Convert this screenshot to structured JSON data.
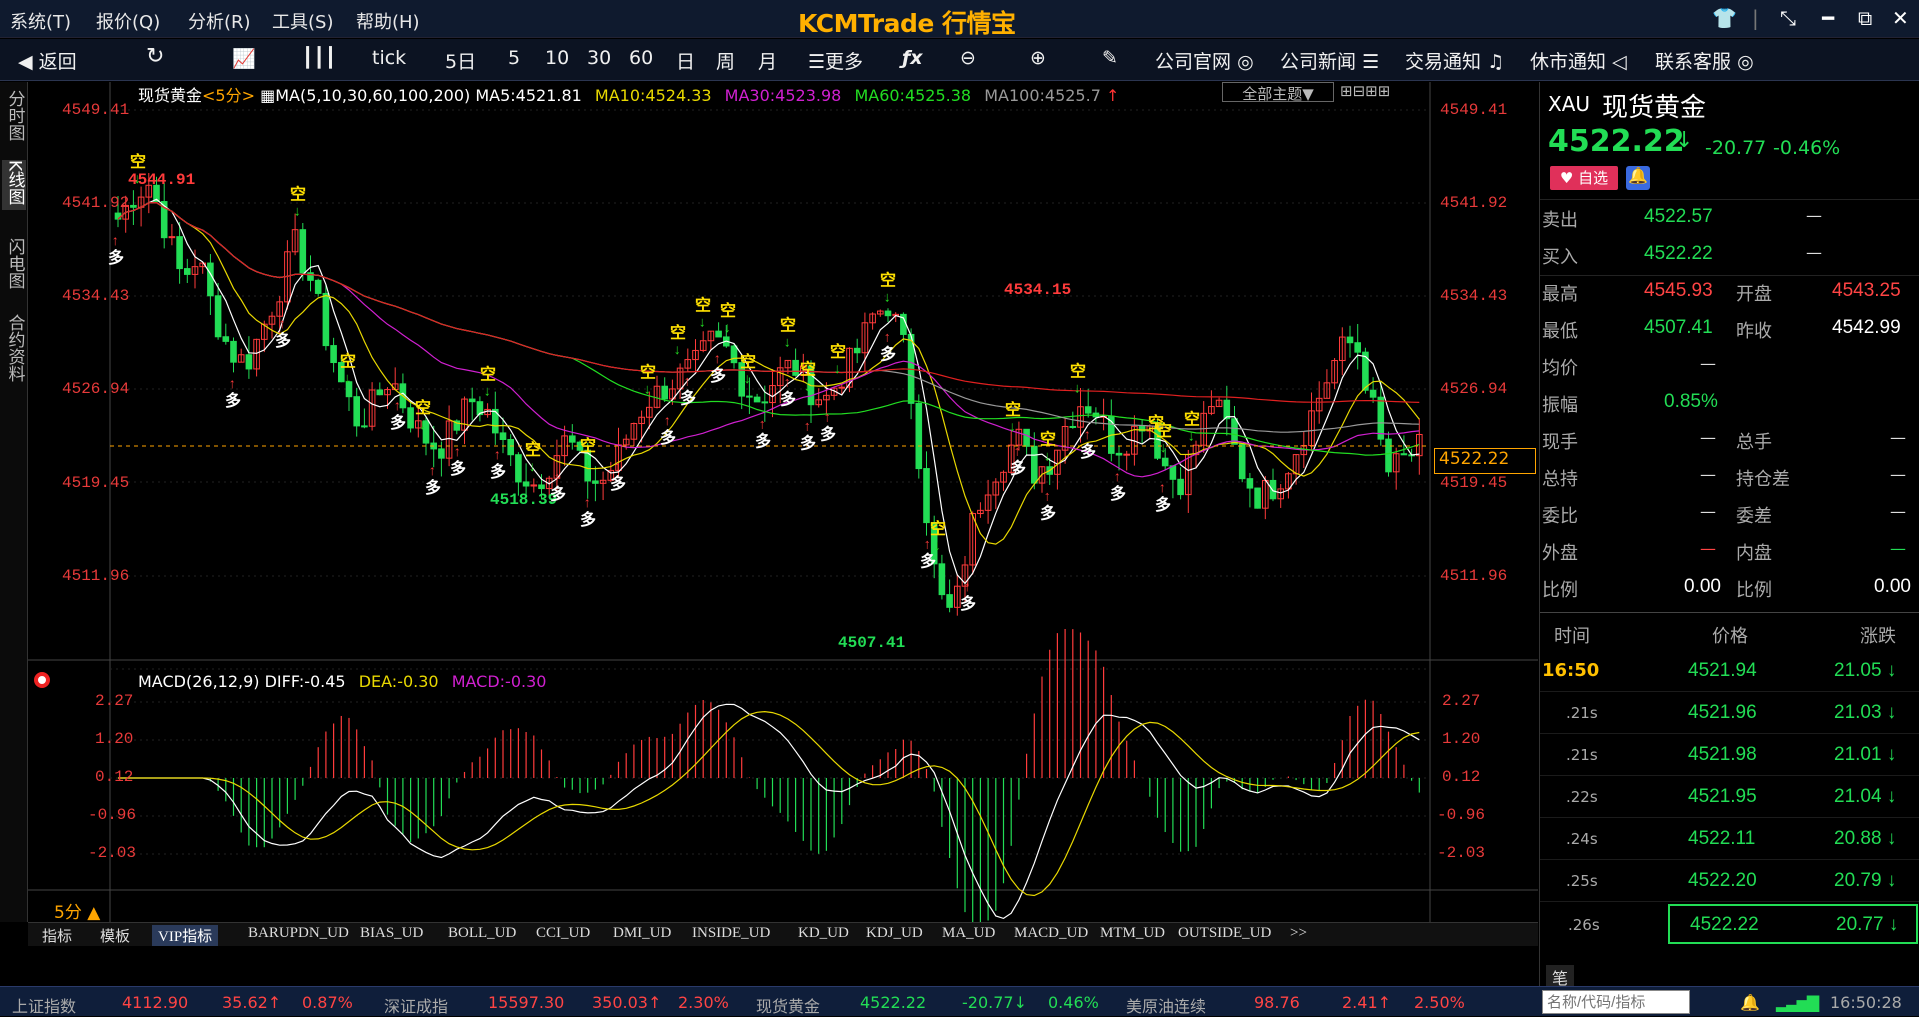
{
  "app": {
    "logo": "KCMTrade 行情宝"
  },
  "menu": [
    "系统(T)",
    "报价(Q)",
    "分析(R)",
    "工具(S)",
    "帮助(H)"
  ],
  "toolbar": {
    "back": "返回",
    "tick": "tick",
    "periods": [
      "5日",
      "5",
      "10",
      "30",
      "60",
      "日",
      "周",
      "月"
    ],
    "more": "更多",
    "links": [
      "公司官网",
      "公司新闻",
      "交易通知",
      "休市通知",
      "联系客服"
    ]
  },
  "left_tabs": [
    "分时图",
    "K线图",
    "闪电图",
    "合约资料"
  ],
  "main_header": {
    "symbol": "现货黄金",
    "period": "<5分>",
    "ma_def": "MA(5,10,30,60,100,200)",
    "ma5": "MA5:4521.81",
    "ma10": "MA10:4524.33",
    "ma30": "MA30:4523.98",
    "ma60": "MA60:4525.38",
    "ma100": "MA100:4525.7",
    "theme": "全部主题▼"
  },
  "price_axis": [
    "4549.41",
    "4541.92",
    "4534.43",
    "4526.94",
    "4519.45",
    "4511.96"
  ],
  "macd_axis": [
    "2.27",
    "1.20",
    "0.12",
    "-0.96",
    "-2.03"
  ],
  "price_tag": "4522.22",
  "annotations": {
    "high1": "4544.91",
    "high2": "4534.15",
    "low1": "4518.39",
    "low2": "4507.41",
    "short": "空",
    "long": "多"
  },
  "macd_header": {
    "def": "MACD(26,12,9)",
    "diff": "DIFF:-0.45",
    "dea": "DEA:-0.30",
    "macd": "MACD:-0.30"
  },
  "period_label": "5分 ▲",
  "bottom_tabs": [
    "指标",
    "模板",
    "VIP指标",
    "BARUPDN_UD",
    "BIAS_UD",
    "BOLL_UD",
    "CCI_UD",
    "DMI_UD",
    "INSIDE_UD",
    "KD_UD",
    "KDJ_UD",
    "MA_UD",
    "MACD_UD",
    "MTM_UD",
    "OUTSIDE_UD",
    ">>"
  ],
  "quote": {
    "code": "XAU",
    "name": "现货黄金",
    "price": "4522.22",
    "arrow": "↓",
    "change": "-20.77",
    "pct": "-0.46%",
    "fav": "自选",
    "sell_label": "卖出",
    "sell": "4522.57",
    "buy_label": "买入",
    "buy": "4522.22",
    "high_label": "最高",
    "high": "4545.93",
    "open_label": "开盘",
    "open": "4543.25",
    "low_label": "最低",
    "low": "4507.41",
    "prev_label": "昨收",
    "prev": "4542.99",
    "avg_label": "均价",
    "amp_label": "振幅",
    "amp": "0.85%",
    "now_label": "现手",
    "total_label": "总手",
    "hold_label": "总持",
    "holddiff_label": "持仓差",
    "wb_label": "委比",
    "wc_label": "委差",
    "out_label": "外盘",
    "in_label": "内盘",
    "ratio_label": "比例",
    "ratio1": "0.00",
    "ratio2": "0.00",
    "dash": "—"
  },
  "ticks_header": {
    "time": "时间",
    "price": "价格",
    "change": "涨跌"
  },
  "ticks": [
    {
      "time": "16:50",
      "price": "4521.94",
      "chg": "21.05"
    },
    {
      "time": ".21s",
      "price": "4521.96",
      "chg": "21.03"
    },
    {
      "time": ".21s",
      "price": "4521.98",
      "chg": "21.01"
    },
    {
      "time": ".22s",
      "price": "4521.95",
      "chg": "21.04"
    },
    {
      "time": ".24s",
      "price": "4522.11",
      "chg": "20.88"
    },
    {
      "time": ".25s",
      "price": "4522.20",
      "chg": "20.79"
    },
    {
      "time": ".26s",
      "price": "4522.22",
      "chg": "20.77"
    }
  ],
  "bi_label": "笔",
  "search_placeholder": "名称/代码/指标",
  "status_bar": [
    {
      "name": "上证指数",
      "val": "4112.90",
      "chg": "35.62↑",
      "pct": "0.87%"
    },
    {
      "name": "深证成指",
      "val": "15597.30",
      "chg": "350.03↑",
      "pct": "2.30%"
    },
    {
      "name": "现货黄金",
      "val": "4522.22",
      "chg": "-20.77↓",
      "pct": "0.46%"
    },
    {
      "name": "美原油连续",
      "val": "98.76",
      "chg": "2.41↑",
      "pct": "2.50%"
    }
  ],
  "clock": "16:50:28",
  "chart_data": {
    "type": "candlestick",
    "symbol": "现货黄金",
    "period": "5分",
    "ylim": [
      4507,
      4550
    ],
    "last": 4522.22,
    "high": 4544.91,
    "low": 4507.41
  }
}
